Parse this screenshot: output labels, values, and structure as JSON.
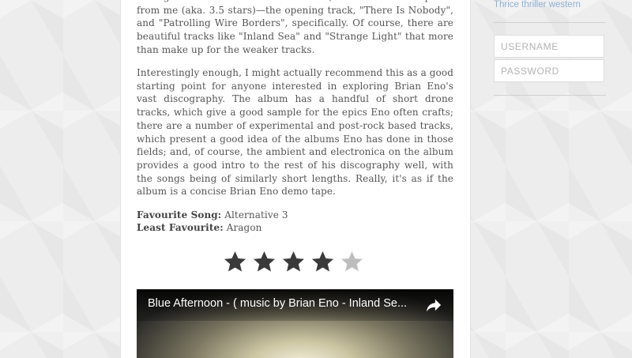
{
  "article": {
    "para1": "managed to elicit an \"I've heard better, but whatever\" response from me (aka. 3.5 stars)—the opening track, \"There Is Nobody\", and \"Patrolling Wire Borders\", specifically. Of course, there are beautiful tracks like \"Inland Sea\" and \"Strange Light\" that more than make up for the weaker tracks.",
    "para2": "Interestingly enough, I might actually recommend this as a good starting point for anyone interested in exploring Brian Eno's vast discography. The album has a handful of short drone tracks, which give a good sample for the epics Eno often crafts; there are a number of experimental and post-rock based tracks, which present a good idea of the albums Eno has done in those fields; and, of course, the ambient and electronica on the album provides a good intro to the rest of his discography well, with the songs being of similarly short lengths. Really, it's as if the album is a concise Brian Eno demo tape.",
    "favourite_label": "Favourite Song:",
    "favourite_value": "Alternative 3",
    "least_label": "Least Favourite:",
    "least_value": "Aragon"
  },
  "rating": {
    "value": 4,
    "max": 5,
    "filled_color": "#3a3a3a",
    "empty_color": "#bdbdbd"
  },
  "video": {
    "title": "Blue Afternoon - ( music by Brian Eno - Inland Se...",
    "share_icon": "share-icon"
  },
  "sidebar": {
    "link_text": "Thrice thriller western",
    "username_placeholder": "USERNAME",
    "password_placeholder": "PASSWORD"
  }
}
